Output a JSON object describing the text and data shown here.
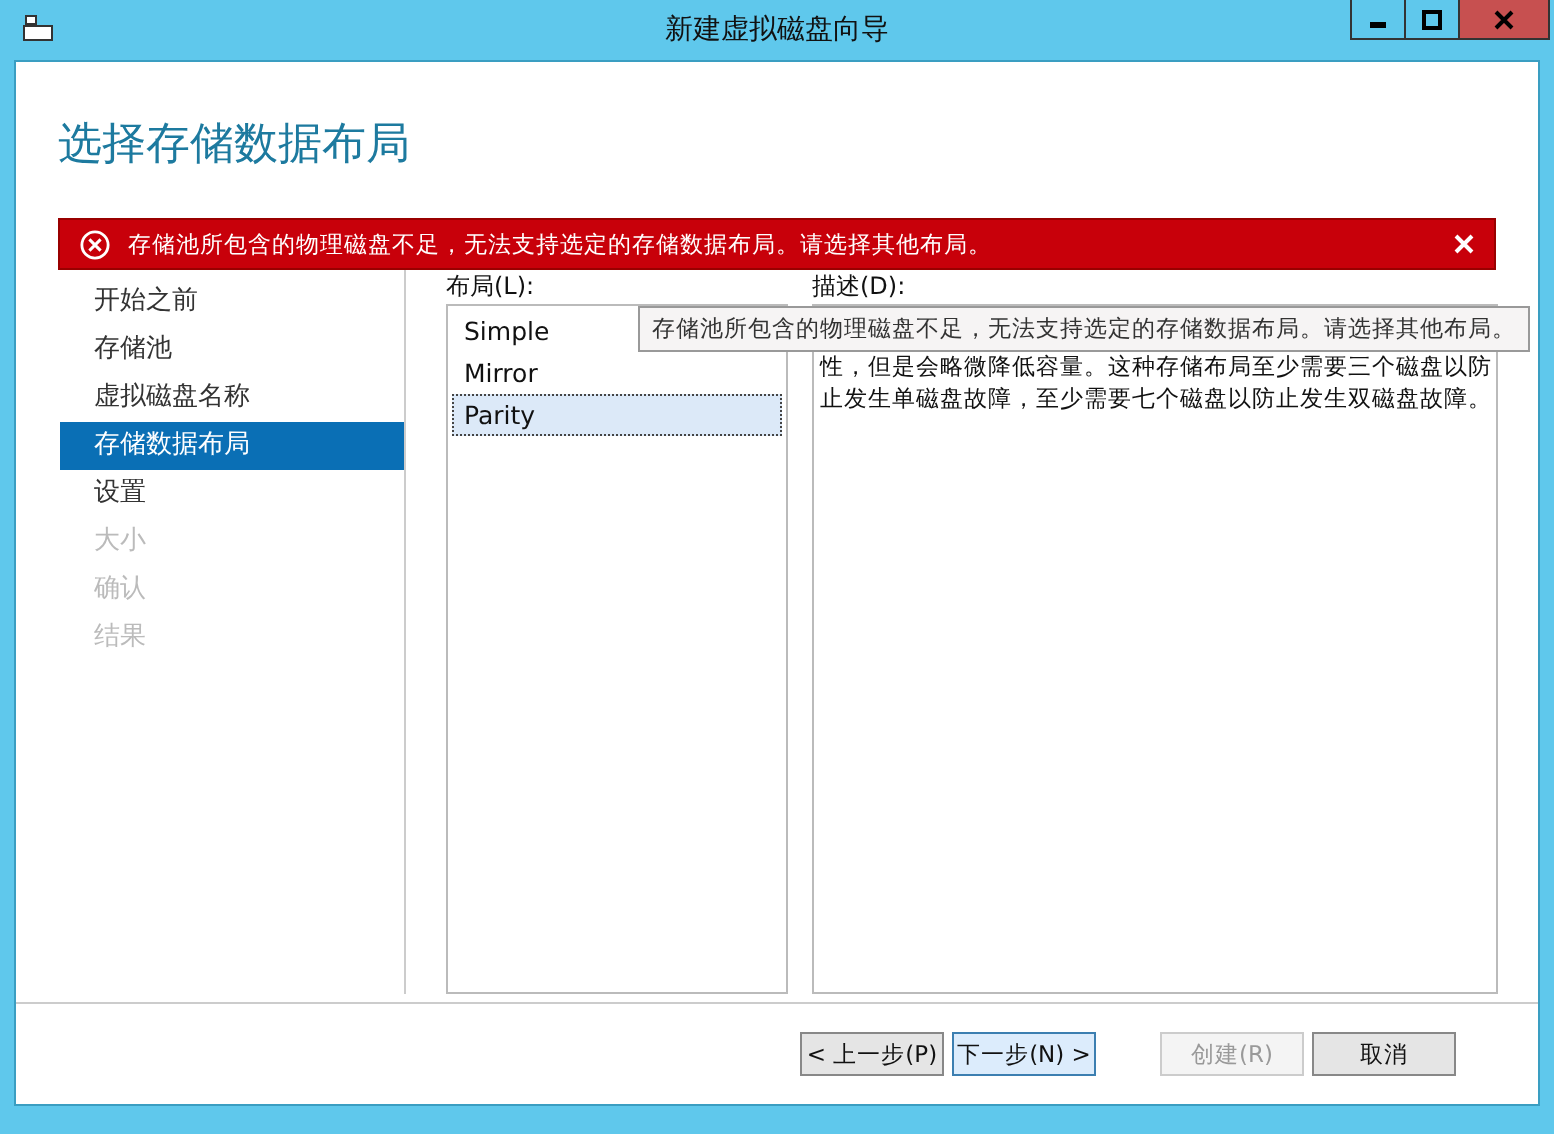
{
  "window": {
    "title": "新建虚拟磁盘向导"
  },
  "page_title": "选择存储数据布局",
  "error_banner": {
    "message": "存储池所包含的物理磁盘不足，无法支持选定的存储数据布局。请选择其他布局。"
  },
  "steps": [
    {
      "label": "开始之前",
      "selected": false,
      "disabled": false
    },
    {
      "label": "存储池",
      "selected": false,
      "disabled": false
    },
    {
      "label": "虚拟磁盘名称",
      "selected": false,
      "disabled": false
    },
    {
      "label": "存储数据布局",
      "selected": true,
      "disabled": false
    },
    {
      "label": "设置",
      "selected": false,
      "disabled": false
    },
    {
      "label": "大小",
      "selected": false,
      "disabled": true
    },
    {
      "label": "确认",
      "selected": false,
      "disabled": true
    },
    {
      "label": "结果",
      "selected": false,
      "disabled": true
    }
  ],
  "layout_list": {
    "label": "布局(L):",
    "items": [
      {
        "label": "Simple",
        "selected": false
      },
      {
        "label": "Mirror",
        "selected": false
      },
      {
        "label": "Parity",
        "selected": true
      }
    ]
  },
  "description": {
    "label": "描述(D):",
    "lines": [
      "性，但是会略微降低容量。这种存储布局至少需要三个磁盘以防",
      "止发生单磁盘故障，至少需要七个磁盘以防止发生双磁盘故障。"
    ]
  },
  "tooltip": "存储池所包含的物理磁盘不足，无法支持选定的存储数据布局。请选择其他布局。",
  "buttons": [
    {
      "label": "< 上一步(P)",
      "kind": "normal"
    },
    {
      "label": "下一步(N) >",
      "kind": "default"
    },
    {
      "label": "创建(R)",
      "kind": "disabled"
    },
    {
      "label": "取消",
      "kind": "normal"
    }
  ]
}
